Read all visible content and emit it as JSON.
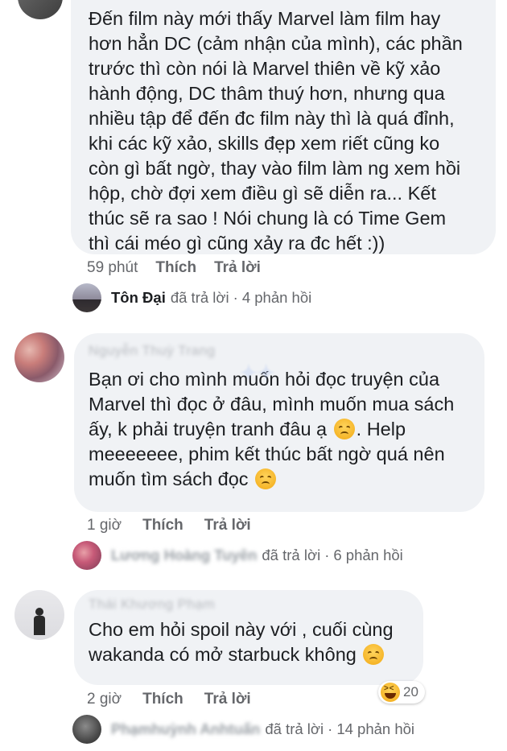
{
  "comments": [
    {
      "text": "Đến film này mới thấy Marvel làm film hay\nhơn hẳn DC (cảm nhận của mình), các phần\ntrước thì còn nói là Marvel thiên về kỹ xảo\nhành động, DC thâm thuý hơn, nhưng qua\nnhiều tập để đến đc film này thì là quá đỉnh,\nkhi các kỹ xảo, skills đẹp xem riết cũng ko\ncòn gì bất ngờ, thay vào film làm ng xem hồi\nhộp, chờ đợi xem điều gì sẽ diễn ra... Kết\nthúc sẽ ra sao ! Nói chung là có Time Gem\nthì cái méo gì cũng xảy ra đc hết :))",
      "time": "59 phút",
      "like": "Thích",
      "reply": "Trả lời",
      "replied_by": "Tôn Đại",
      "replied_text": "đã trả lời",
      "reply_count": "4 phản hồi"
    },
    {
      "author_blurred": "Nguyễn Thuỳ Trang",
      "text_parts": [
        "Bạn ơi cho mình muốn hỏi đọc truyện của\nMarvel thì đọc ở đâu, mình muốn mua sách\nấy, k phải truyện tranh đâu ạ ",
        ". Help\nmeeeeeee, phim kết thúc bất ngờ quá nên\nmuốn tìm sách đọc "
      ],
      "time": "1 giờ",
      "like": "Thích",
      "reply": "Trả lời",
      "replied_by_blurred": "Lương Hoàng Tuyên",
      "replied_text": "đã trả lời",
      "reply_count": "6 phản hồi"
    },
    {
      "author_blurred": "Thái Khương Phạm",
      "text_parts": [
        "Cho em hỏi spoil này với , cuối cùng\nwakanda có mở starbuck không "
      ],
      "time": "2 giờ",
      "like": "Thích",
      "reply": "Trả lời",
      "reaction_count": "20",
      "replied_by_blurred": "Phạmhuỳnh Anhtuấn",
      "replied_text": "đã trả lời",
      "reply_count": "14 phản hồi"
    }
  ],
  "icons": {
    "sad_emoji": "disappointed-face-icon",
    "haha_reaction": "haha-reaction-icon"
  },
  "colors": {
    "bubble": "#f0f2f5",
    "meta_text": "#65676b",
    "text": "#1c1e21"
  }
}
